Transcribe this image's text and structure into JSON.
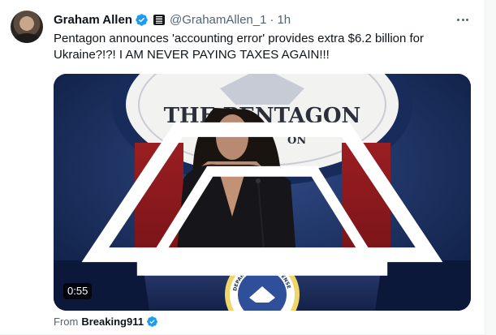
{
  "tweet": {
    "author_name": "Graham Allen",
    "handle": "@GrahamAllen_1",
    "separator": "·",
    "time": "1h",
    "text": "Pentagon announces 'accounting error' provides extra $6.2 billion for Ukraine?!?! I AM NEVER PAYING TAXES AGAIN!!!"
  },
  "media": {
    "duration": "0:55",
    "backdrop_text": "THE PENTAGON",
    "backdrop_subtext": "ON",
    "seal_text": "DEPARTMENT OF DEFENSE"
  },
  "attribution": {
    "label": "From",
    "source": "Breaking911"
  },
  "icons": {
    "verified": "verified-badge-icon",
    "affiliate": "flag-badge-icon",
    "more": "more-horizontal-icon"
  },
  "colors": {
    "verified_blue": "#1d9bf0",
    "secondary_text": "#536471",
    "primary_text": "#0f1419"
  }
}
